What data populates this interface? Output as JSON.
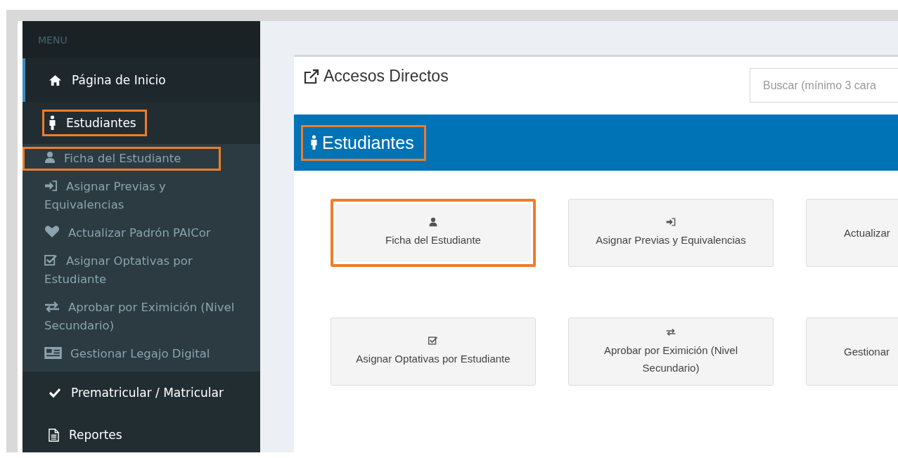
{
  "sidebar": {
    "header": "MENU",
    "items": [
      {
        "label": "Página de Inicio",
        "selected": true,
        "highlighted": false
      },
      {
        "label": "Estudiantes",
        "selected": false,
        "highlighted": true,
        "children": [
          {
            "label": "Ficha del Estudiante",
            "highlighted": true
          },
          {
            "label": "Asignar Previas y Equivalencias",
            "highlighted": false
          },
          {
            "label": "Actualizar Padrón PAICor",
            "highlighted": false
          },
          {
            "label": "Asignar Optativas por Estudiante",
            "highlighted": false
          },
          {
            "label": "Aprobar por Eximición (Nivel Secundario)",
            "highlighted": false
          },
          {
            "label": "Gestionar Legajo Digital",
            "highlighted": false
          }
        ]
      },
      {
        "label": "Prematricular / Matricular",
        "selected": false,
        "highlighted": false
      },
      {
        "label": "Reportes",
        "selected": false,
        "highlighted": false
      }
    ]
  },
  "panel": {
    "title": "Accesos Directos",
    "search": {
      "placeholder": "Buscar (mínimo 3 cara"
    },
    "section": {
      "title": "Estudiantes",
      "highlighted": true
    },
    "cards": [
      {
        "label": "Ficha del Estudiante",
        "highlighted": true
      },
      {
        "label": "Asignar Previas y Equivalencias",
        "highlighted": false
      },
      {
        "label": "Actualizar",
        "highlighted": false
      },
      {
        "label": "Asignar Optativas por Estudiante",
        "highlighted": false
      },
      {
        "label": "Aprobar por Eximición (Nivel Secundario)",
        "highlighted": false
      },
      {
        "label": "Gestionar",
        "highlighted": false
      }
    ]
  }
}
